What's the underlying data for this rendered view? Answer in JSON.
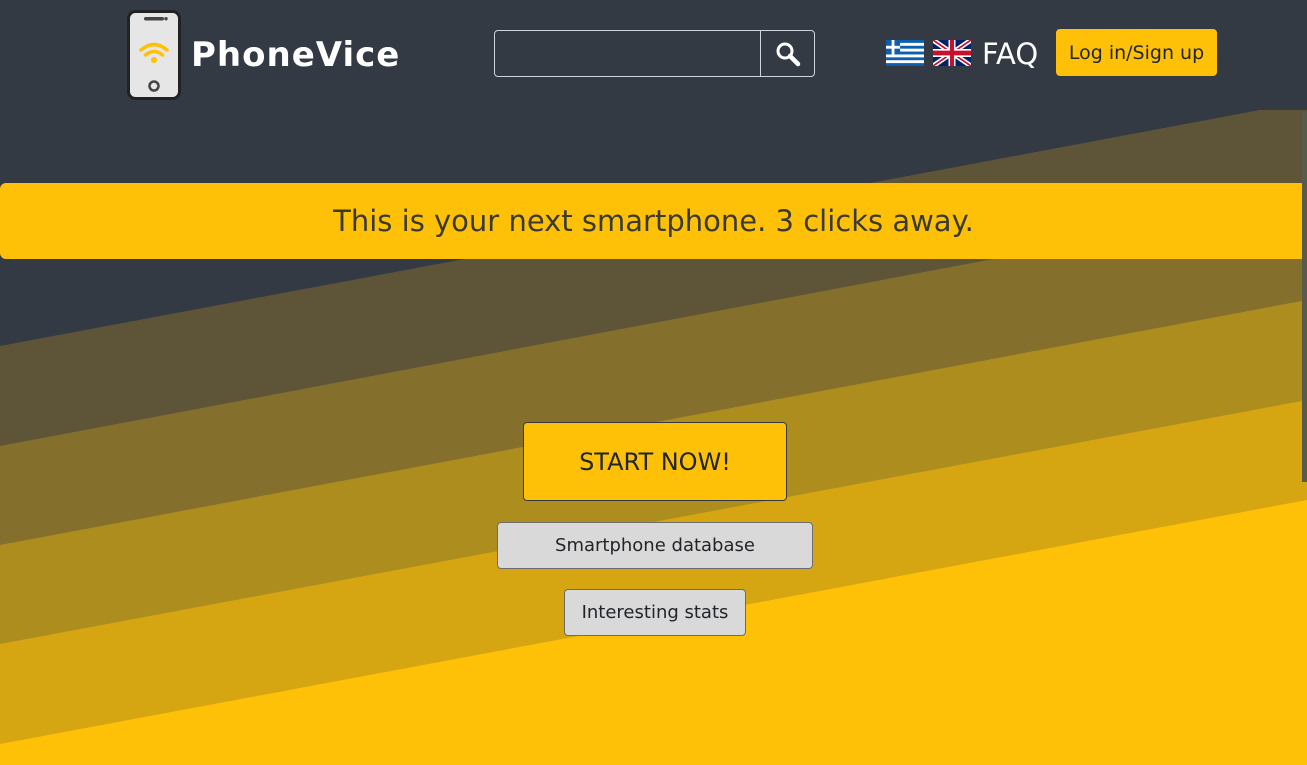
{
  "colors": {
    "header_bg": "#343a43",
    "accent": "#ffc107",
    "stripe_1": "#5e5538",
    "stripe_2": "#84702c",
    "stripe_3": "#ae8d1f",
    "stripe_4": "#d5a612",
    "stripe_5": "#ffc107",
    "secondary_btn": "#d9d9d9"
  },
  "header": {
    "brand": "PhoneVice",
    "logo_icon": "phone-wifi-icon",
    "search": {
      "placeholder": "",
      "value": "",
      "button_icon": "search-icon"
    },
    "languages": [
      {
        "icon": "greece-flag-icon"
      },
      {
        "icon": "uk-flag-icon"
      }
    ],
    "faq_label": "FAQ",
    "login_label": "Log in/Sign up"
  },
  "main": {
    "tagline": "This is your next smartphone. 3 clicks away.",
    "start_label": "START NOW!",
    "database_label": "Smartphone database",
    "stats_label": "Interesting stats"
  }
}
